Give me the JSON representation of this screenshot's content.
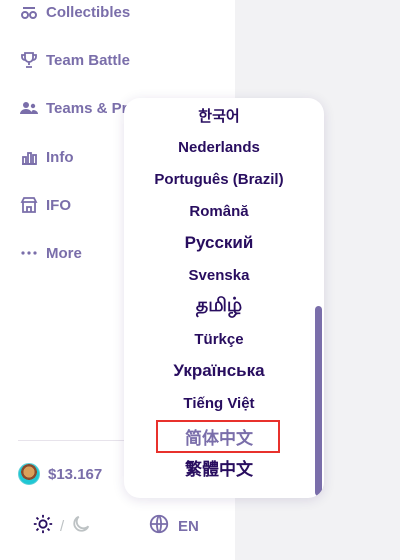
{
  "nav": {
    "items": [
      {
        "label": "Collectibles",
        "icon": "collectibles-icon"
      },
      {
        "label": "Team Battle",
        "icon": "trophy-icon"
      },
      {
        "label": "Teams & Pr",
        "icon": "teams-icon"
      },
      {
        "label": "Info",
        "icon": "info-chart-icon"
      },
      {
        "label": "IFO",
        "icon": "ifo-icon"
      },
      {
        "label": "More",
        "icon": "more-dots-icon"
      }
    ]
  },
  "footer": {
    "price": "$13.167",
    "price_token_icon": "cake-token-icon",
    "theme_separator": "/",
    "language_code": "EN"
  },
  "language_menu": {
    "items": [
      "한국어",
      "Nederlands",
      "Português (Brazil)",
      "Română",
      "Русский",
      "Svenska",
      "தமிழ்",
      "Türkçe",
      "Українська",
      "Tiếng Việt",
      "简体中文",
      "繁體中文"
    ],
    "highlighted": "简体中文"
  },
  "colors": {
    "text_primary": "#280d5f",
    "text_secondary": "#7a6eaa",
    "highlight_border": "#e8312c",
    "background_main": "#f2f2f4"
  }
}
